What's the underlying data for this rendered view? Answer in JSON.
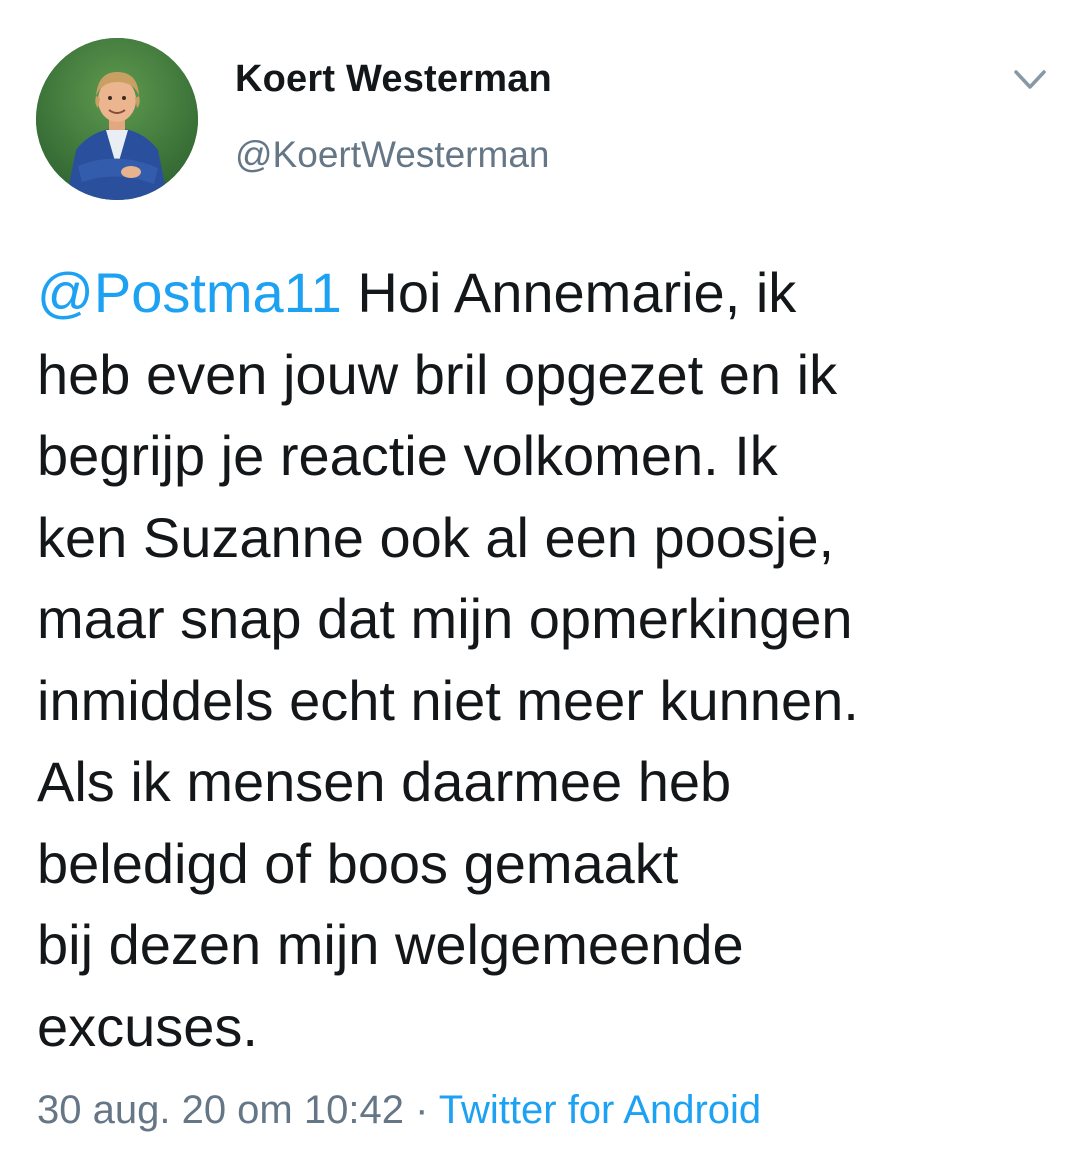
{
  "tweet": {
    "author": {
      "display_name": "Koert Westerman",
      "handle": "@KoertWesterman"
    },
    "menu_icon": "chevron-down-icon",
    "body": {
      "mention": "@Postma11",
      "first_line_rest": " Hoi Annemarie, ik",
      "lines": [
        "heb even jouw bril opgezet en ik",
        "begrijp je reactie volkomen. Ik",
        "ken Suzanne ook al een poosje,",
        "maar snap dat mijn opmerkingen",
        "inmiddels echt niet meer kunnen.",
        "Als ik mensen daarmee heb",
        "beledigd of boos gemaakt",
        "bij dezen mijn welgemeende",
        "excuses."
      ]
    },
    "meta": {
      "timestamp": "30 aug. 20 om 10:42",
      "separator": " · ",
      "source": "Twitter for Android"
    }
  },
  "colors": {
    "text": "#14171a",
    "secondary": "#657786",
    "link": "#1da1f2",
    "avatar_bg": "#3f7a3c"
  }
}
